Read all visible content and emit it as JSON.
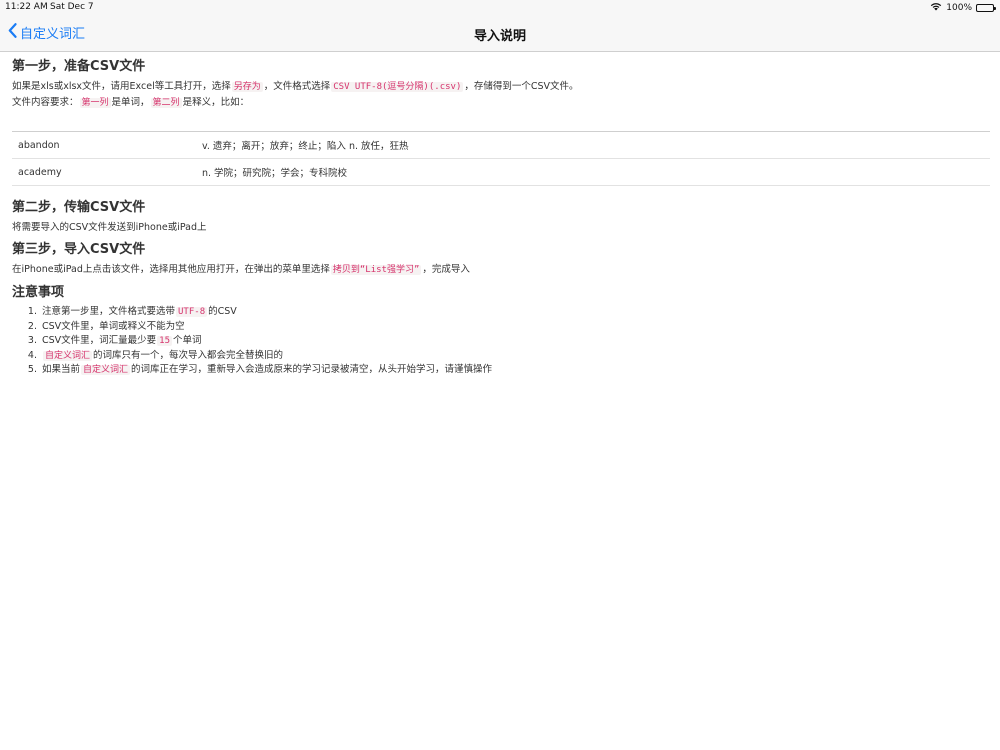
{
  "status_bar": {
    "time": "11:22 AM",
    "date": "Sat Dec 7",
    "battery": "100%",
    "battery_level": 1.0
  },
  "nav": {
    "back_label": "自定义词汇",
    "title": "导入说明"
  },
  "step1": {
    "title": "第一步，准备CSV文件",
    "line1": {
      "t1": "如果是xls或xlsx文件，请用Excel等工具打开，选择",
      "c1": "另存为",
      "t2": "，文件格式选择",
      "c2": "CSV UTF-8(逗号分隔)(.csv)",
      "t3": "，存储得到一个CSV文件。"
    },
    "line2": {
      "t1": "文件内容要求：",
      "c1": "第一列",
      "t2": "是单词，",
      "c2": "第二列",
      "t3": "是释义，比如："
    }
  },
  "example_table": {
    "rows": [
      {
        "word": "abandon",
        "definition": "v. 遗弃；离开；放弃；终止；陷入 n. 放任，狂热"
      },
      {
        "word": "academy",
        "definition": "n. 学院；研究院；学会；专科院校"
      }
    ]
  },
  "step2": {
    "title": "第二步，传输CSV文件",
    "text": "将需要导入的CSV文件发送到iPhone或iPad上"
  },
  "step3": {
    "title": "第三步，导入CSV文件",
    "t1": "在iPhone或iPad上点击该文件，选择用其他应用打开，在弹出的菜单里选择",
    "c1": "拷贝到“List强学习”",
    "t2": "，完成导入"
  },
  "notes": {
    "title": "注意事项",
    "items": [
      {
        "t1": "注意第一步里，文件格式要选带",
        "c1": "UTF-8",
        "t2": "的CSV"
      },
      {
        "t1": "CSV文件里，单词或释义不能为空"
      },
      {
        "t1": "CSV文件里，词汇量最少要",
        "c1": "15",
        "t2": "个单词"
      },
      {
        "c1": "自定义词汇",
        "t2": "的词库只有一个，每次导入都会完全替换旧的"
      },
      {
        "t1": "如果当前",
        "c1": "自定义词汇",
        "t2": "的词库正在学习，重新导入会造成原来的学习记录被清空，从头开始学习，请谨慎操作"
      }
    ]
  },
  "colors": {
    "accent": "#1a7cf5",
    "code_text": "#d6336c",
    "code_bg": "#f6f2f2"
  }
}
